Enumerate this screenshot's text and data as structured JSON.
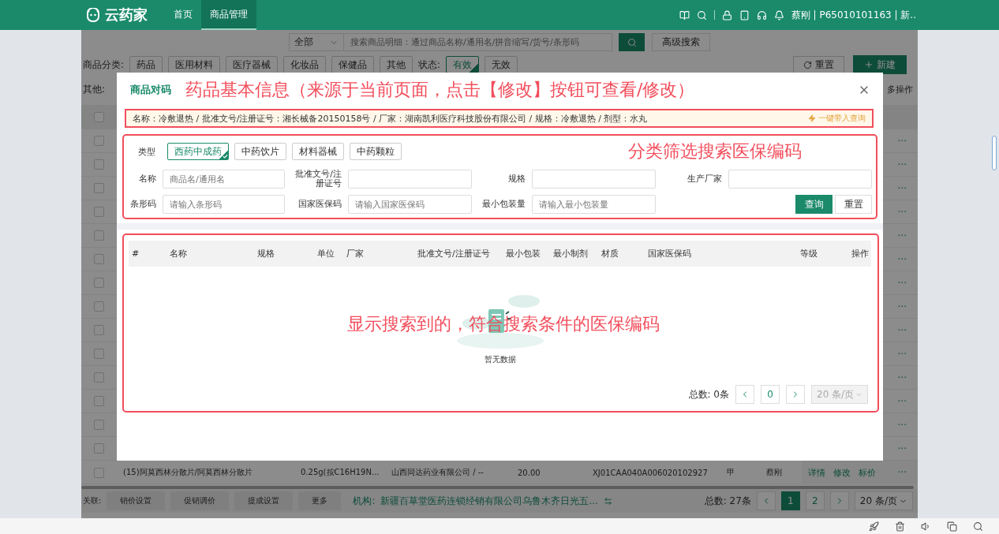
{
  "topbar": {
    "logo": "云药家",
    "nav": [
      {
        "label": "首页",
        "selected": false
      },
      {
        "label": "商品管理",
        "selected": true
      }
    ],
    "user": "蔡刚 | P65010101163 | 新.."
  },
  "search": {
    "scope": "全部",
    "placeholder": "搜索商品明细：通过商品名称/通用名/拼音缩写/货号/条形码",
    "advanced": "高级搜索"
  },
  "filters": {
    "category_label": "商品分类:",
    "categories": [
      {
        "label": "药品",
        "selected": false
      },
      {
        "label": "医用材料",
        "selected": false
      },
      {
        "label": "医疗器械",
        "selected": false
      },
      {
        "label": "化妆品",
        "selected": false
      },
      {
        "label": "保健品",
        "selected": false
      },
      {
        "label": "其他",
        "selected": false
      }
    ],
    "status_label": "状态:",
    "statuses": [
      {
        "label": "有效",
        "selected": true
      },
      {
        "label": "无效",
        "selected": false
      }
    ],
    "reset": "重置",
    "create": "新建",
    "other_label": "其他:",
    "more_ops": "多操作"
  },
  "list": {
    "header_checked": false,
    "rows": [
      {
        "checked": false,
        "more": "···"
      },
      {
        "checked": false,
        "more": "···"
      },
      {
        "checked": false,
        "more": "···"
      },
      {
        "checked": false,
        "more": "···"
      },
      {
        "checked": false,
        "more": "···"
      },
      {
        "checked": false,
        "more": "···"
      },
      {
        "checked": false,
        "more": "···"
      },
      {
        "checked": false,
        "more": "···"
      },
      {
        "checked": false,
        "more": "···"
      },
      {
        "checked": false,
        "more": "···"
      },
      {
        "checked": false,
        "more": "···"
      },
      {
        "checked": false,
        "more": "···"
      },
      {
        "checked": false,
        "more": "···"
      },
      {
        "checked": false,
        "more": "···"
      },
      {
        "checked": false,
        "cells": [
          "(15)阿莫西林分散片/阿莫西林分散片",
          "0.25g(按C16H19N...",
          "山西同达药业有限公司 / --",
          "20.00",
          "XJ01CAA040A006020102927",
          "甲",
          "蔡刚"
        ],
        "actions": [
          "详情",
          "修改",
          "标价"
        ],
        "more": "···"
      }
    ]
  },
  "footer": {
    "related_label": "关联:",
    "related": [
      "销价设置",
      "促销调价",
      "提成设置",
      "更多"
    ],
    "org_label": "机构:",
    "org": "新疆百草堂医药连锁经销有限公司乌鲁木齐日光五...",
    "total": "总数: 27条",
    "pages": [
      {
        "label": "1",
        "selected": true
      },
      {
        "label": "2",
        "selected": false
      }
    ],
    "size": "20 条/页"
  },
  "modal": {
    "title": "商品对码",
    "note": "药品基本信息（来源于当前页面，点击【修改】按钮可查看/修改）",
    "info": "名称：冷敷退热 / 批准文号/注册证号：湘长械备20150158号 / 厂家：湖南凯利医疗科技股份有限公司 / 规格：冷敷退热 / 剂型：水丸",
    "fill_link": "一键带入查询",
    "type_label": "类型",
    "types": [
      {
        "label": "西药中成药",
        "selected": true
      },
      {
        "label": "中药饮片",
        "selected": false
      },
      {
        "label": "材料器械",
        "selected": false
      },
      {
        "label": "中药颗粒",
        "selected": false
      }
    ],
    "type_note": "分类筛选搜索医保编码",
    "fields": [
      {
        "label": "名称",
        "placeholder": "商品名/通用名"
      },
      {
        "label": "批准文号/注册证号"
      },
      {
        "label": "规格"
      },
      {
        "label": "生产厂家"
      },
      {
        "label": "条形码",
        "placeholder": "请输入条形码"
      },
      {
        "label": "国家医保码",
        "placeholder": "请输入国家医保码"
      },
      {
        "label": "最小包装量",
        "placeholder": "请输入最小包装量"
      }
    ],
    "query": "查询",
    "reset": "重置",
    "columns": [
      "#",
      "名称",
      "规格",
      "单位",
      "厂家",
      "批准文号/注册证号",
      "最小包装",
      "最小制剂",
      "材质",
      "国家医保码",
      "等级",
      "操作"
    ],
    "empty": "暂无数据",
    "result_note": "显示搜索到的，符合搜索条件的医保编码",
    "pager": {
      "total": "总数: 0条",
      "page": "0",
      "size": "20 条/页"
    }
  }
}
